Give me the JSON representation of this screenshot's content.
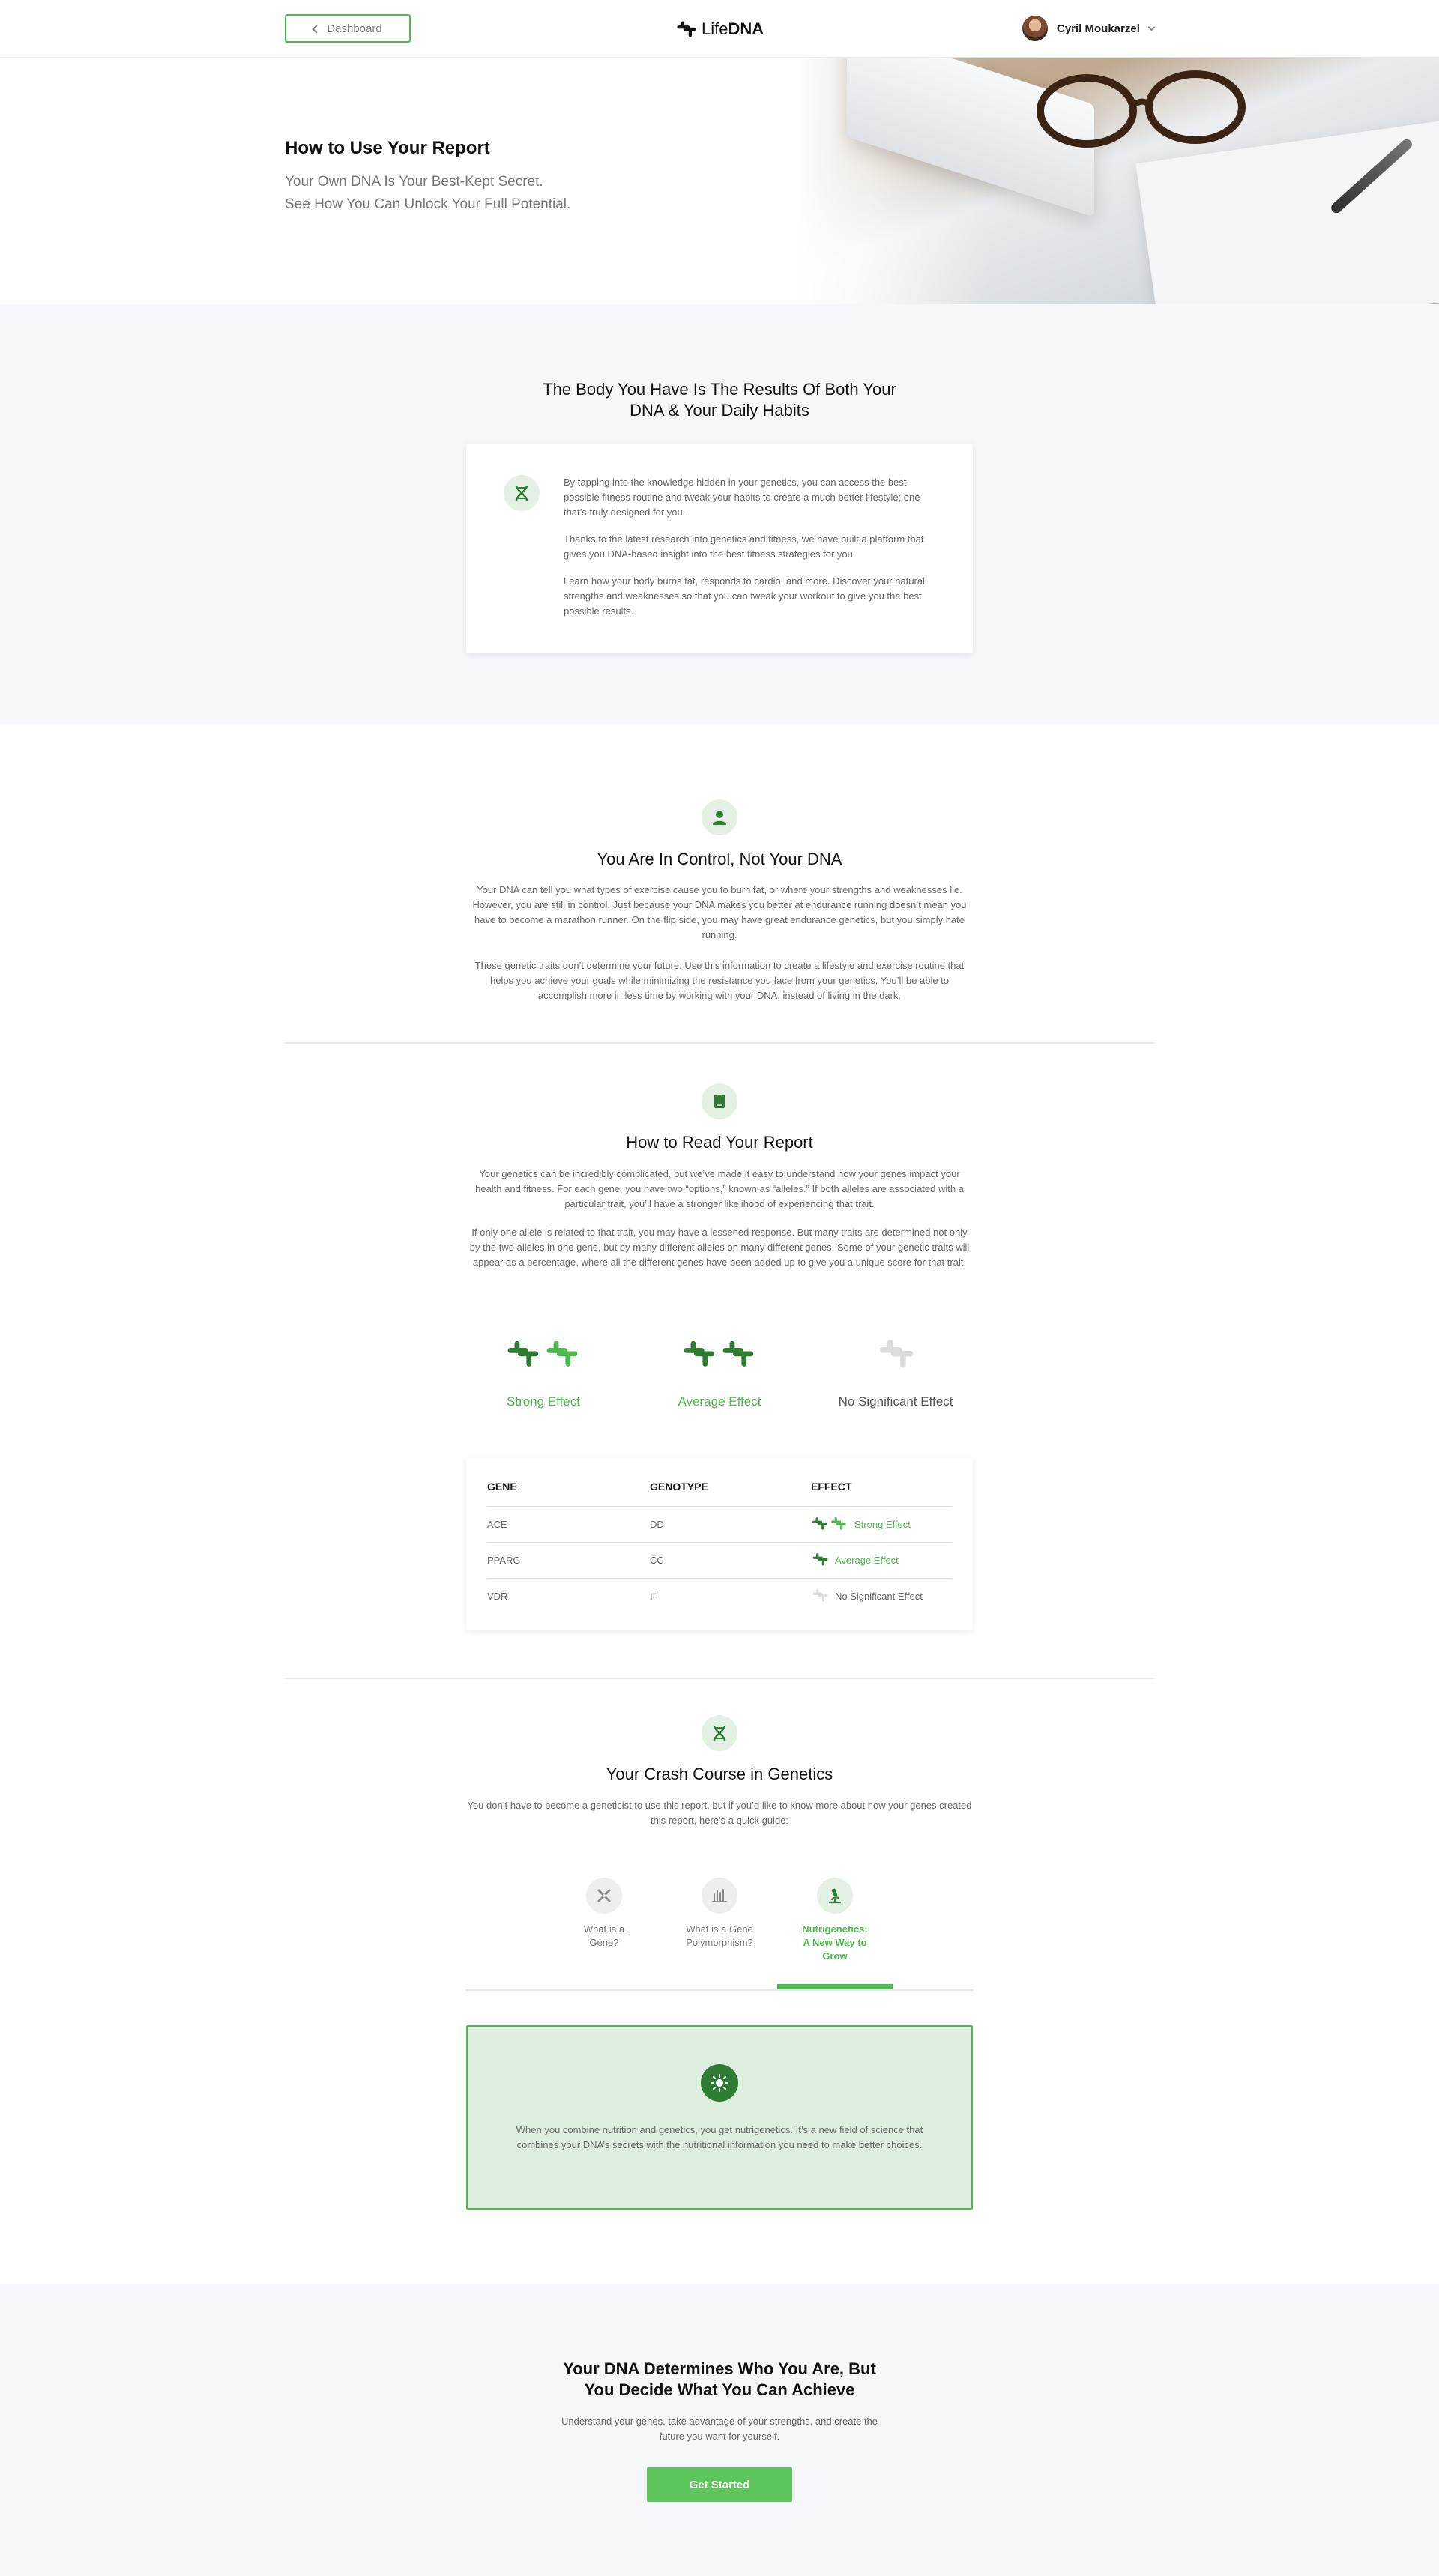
{
  "header": {
    "dashboard_label": "Dashboard",
    "logo_light": "Life",
    "logo_bold": "DNA",
    "user_name": "Cyril Moukarzel"
  },
  "hero": {
    "title": "How to Use Your Report",
    "subtitle_line1": "Your Own DNA Is Your Best-Kept Secret.",
    "subtitle_line2": "See How You Can Unlock Your Full Potential."
  },
  "intro": {
    "title_line1": "The Body You Have Is The Results Of Both Your",
    "title_line2": "DNA & Your Daily Habits",
    "paragraphs": [
      "By tapping into the knowledge hidden in your genetics, you can access the best possible fitness routine and tweak your habits to create a much better lifestyle; one that’s truly designed for you.",
      "Thanks to the latest research into genetics and fitness, we have built a platform that gives you DNA-based insight into the best fitness strategies for you.",
      "Learn how your body burns fat, responds to cardio, and more. Discover your natural strengths and weaknesses so that you can tweak your workout to give you the best possible results."
    ]
  },
  "control": {
    "title": "You Are In Control, Not Your DNA",
    "p1": "Your DNA can tell you what types of exercise cause you to burn fat, or where your strengths and weaknesses lie. However, you are still in control. Just because your DNA makes you better at endurance running doesn’t mean you have to become a marathon runner. On the flip side, you may have great endurance genetics, but you simply hate running.",
    "p2": "These genetic traits don’t determine your future. Use this information to create a lifestyle and exercise routine that helps you achieve your goals while minimizing the resistance you face from your genetics. You’ll be able to accomplish more in less time by working with your DNA, instead of living in the dark."
  },
  "read": {
    "title": "How to Read Your Report",
    "p1": "Your genetics can be incredibly complicated, but we’ve made it easy to understand how your genes impact your health and fitness. For each gene, you have two “options,” known as “alleles.” If both alleles are associated with a particular trait, you’ll have a stronger likelihood of experiencing that trait.",
    "p2": "If only one allele is related to that trait, you may have a lessened response. But many traits are determined not only by the two alleles in one gene, but by many different alleles on many different genes. Some of your genetic traits will appear as a percentage, where all the different genes have been added up to give you a unique score for that trait.",
    "effects": [
      "Strong Effect",
      "Average Effect",
      "No Significant Effect"
    ]
  },
  "table": {
    "headers": [
      "GENE",
      "GENOTYPE",
      "EFFECT"
    ],
    "rows": [
      {
        "gene": "ACE",
        "genotype": "DD",
        "effect": "Strong Effect"
      },
      {
        "gene": "PPARG",
        "genotype": "CC",
        "effect": "Average Effect"
      },
      {
        "gene": "VDR",
        "genotype": "II",
        "effect": "No Significant Effect"
      }
    ]
  },
  "crash": {
    "title": "Your Crash Course in Genetics",
    "p": "You don’t have to become a geneticist to use this report, but if you’d like to know more about how your genes created this report, here’s a quick guide:",
    "tabs": [
      {
        "line1": "What is a",
        "line2": "Gene?",
        "line3": ""
      },
      {
        "line1": "What is a Gene",
        "line2": "Polymorphism?",
        "line3": ""
      },
      {
        "line1": "Nutrigenetics:",
        "line2": "A New Way to",
        "line3": "Grow"
      }
    ],
    "box_text": "When you combine nutrition and genetics, you get nutrigenetics. It’s a new field of science that combines your DNA’s secrets with the nutritional information you need to make better choices."
  },
  "cta": {
    "title_line1": "Your DNA Determines Who You Are, But",
    "title_line2": "You Decide What You Can Achieve",
    "sub_line1": "Understand your genes, take advantage of your strengths, and create the",
    "sub_line2": "future you want for yourself.",
    "button": "Get Started"
  },
  "colors": {
    "brand_green": "#4cba4c",
    "dark_green": "#2e7d32",
    "light_green_bg": "#deeede",
    "section_bg": "#f5f7fa"
  }
}
